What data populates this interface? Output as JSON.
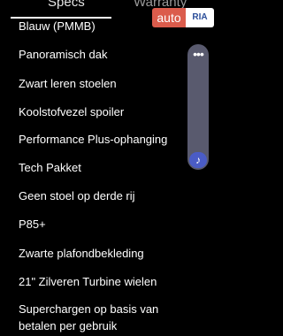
{
  "tabs": [
    {
      "label": "Specs"
    },
    {
      "label": "Warranty"
    }
  ],
  "logo": {
    "left": "auto",
    "right": "RIA",
    "left_color": "#db5c4c",
    "right_color": "#2c4f9a"
  },
  "options": [
    "Blauw (PMMB)",
    "Panoramisch dak",
    "Zwart leren stoelen",
    "Koolstofvezel spoiler",
    "Performance Plus-ophanging",
    "Tech Pakket",
    "Geen stoel op derde rij",
    "P85+",
    "Zwarte plafondbekleding",
    "21\" Zilveren Turbine wielen",
    "Superchargen op basis van betalen per gebruik"
  ],
  "scroll_controls": {
    "more_icon": "more-dots-icon",
    "thumb_icon": "music-note-icon",
    "accent": "#4a5cc6"
  }
}
